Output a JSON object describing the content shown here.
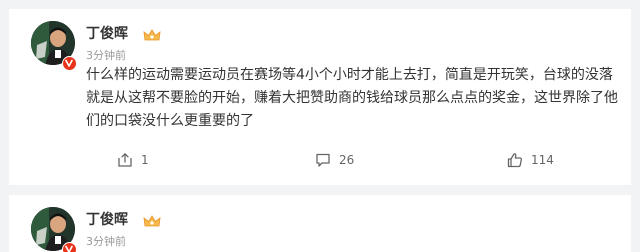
{
  "posts": [
    {
      "username": "丁俊晖",
      "timestamp": "3分钟前",
      "content": "什么样的运动需要运动员在赛场等4小个小时才能上去打，简直是开玩笑，台球的没落就是从这帮不要脸的开始，赚着大把赞助商的钱给球员那么点点的奖金，这世界除了他们的口袋没什么更重要的了",
      "actions": {
        "share_count": "1",
        "comment_count": "26",
        "like_count": "114"
      }
    },
    {
      "username": "丁俊晖",
      "timestamp": "3分钟前"
    }
  ],
  "icons": {
    "share": "share-icon",
    "comment": "comment-icon",
    "like": "thumbs-up-icon",
    "verified": "verified-badge-icon",
    "fan_badge": "fan-badge-icon"
  },
  "colors": {
    "background": "#f2f3f5",
    "card": "#ffffff",
    "text": "#333333",
    "muted": "#999999",
    "verified_badge": "#e8341a",
    "fan_badge": "#f5a623"
  }
}
